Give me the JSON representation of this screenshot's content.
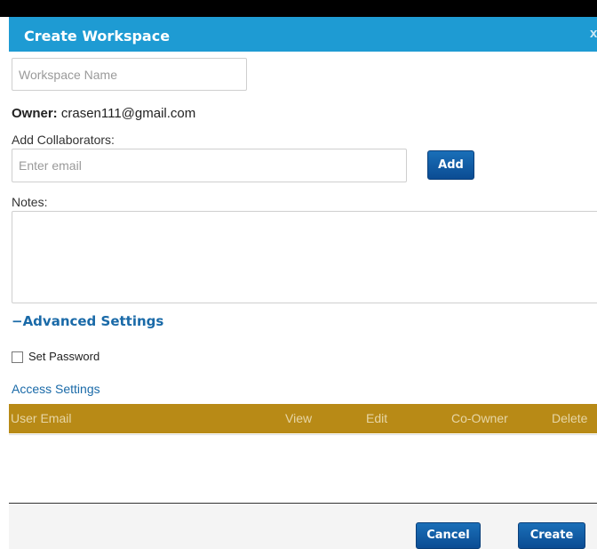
{
  "dialog": {
    "title": "Create Workspace",
    "close_label": "x"
  },
  "workspace_name": {
    "placeholder": "Workspace Name",
    "value": ""
  },
  "owner": {
    "label": "Owner:",
    "email": "crasen111@gmail.com"
  },
  "collaborators": {
    "label": "Add Collaborators:",
    "placeholder": "Enter email",
    "add_label": "Add"
  },
  "notes": {
    "label": "Notes:",
    "value": ""
  },
  "advanced": {
    "toggle_label": "−Advanced Settings",
    "set_password_label": "Set Password",
    "set_password_checked": false,
    "access_settings_label": "Access Settings"
  },
  "access_table": {
    "columns": [
      "User Email",
      "View",
      "Edit",
      "Co-Owner",
      "Delete"
    ],
    "rows": []
  },
  "footer": {
    "cancel_label": "Cancel",
    "create_label": "Create"
  },
  "colors": {
    "titlebar": "#1e9bd3",
    "table_header": "#b88a16",
    "link": "#1a6aa8",
    "button": "#0b4c93"
  }
}
